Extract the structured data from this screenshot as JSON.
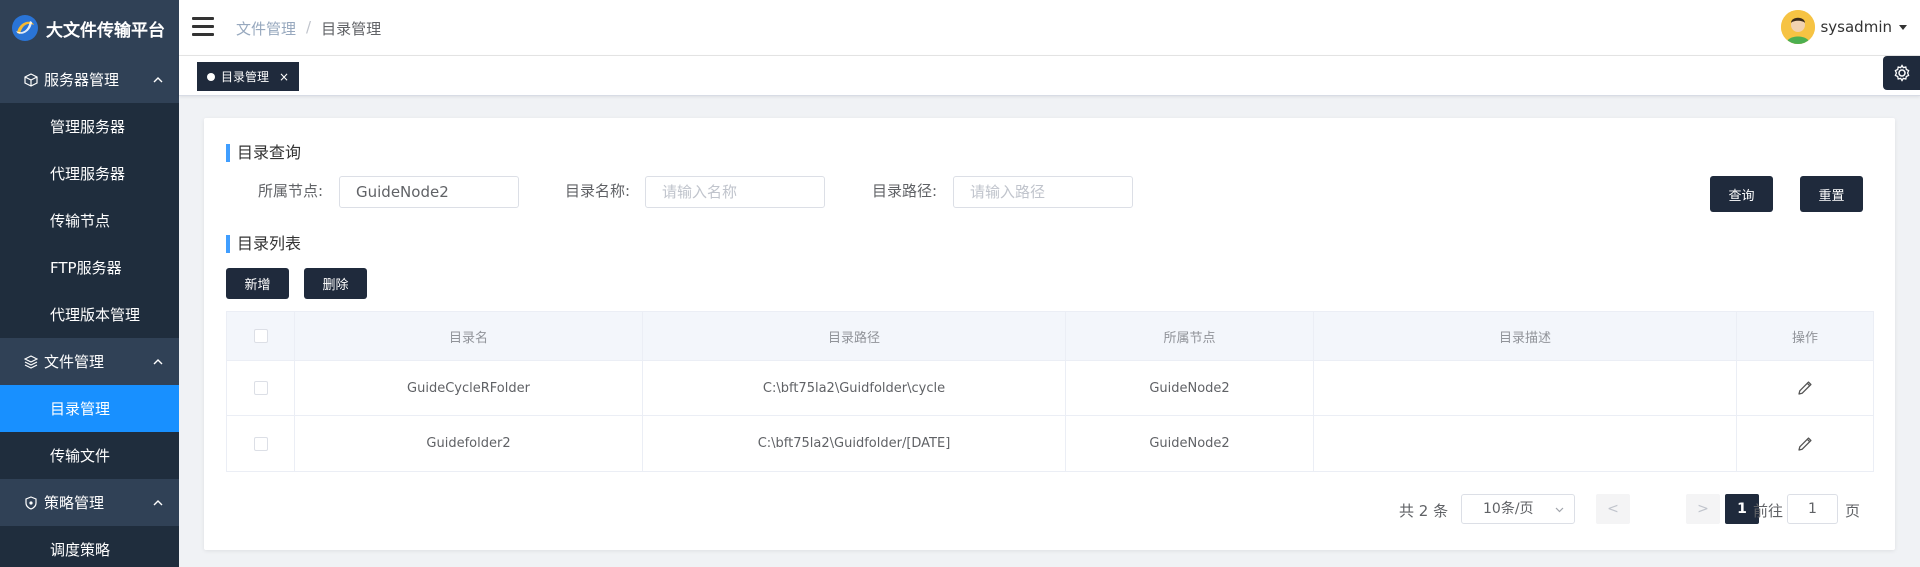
{
  "brand": {
    "title": "大文件传输平台",
    "logo_icon": "swirl-logo-icon"
  },
  "sidebar": {
    "groups": [
      {
        "label": "服务器管理",
        "icon": "cube-icon",
        "items": [
          "管理服务器",
          "代理服务器",
          "传输节点",
          "FTP服务器",
          "代理版本管理"
        ]
      },
      {
        "label": "文件管理",
        "icon": "layers-icon",
        "items": [
          "目录管理",
          "传输文件"
        ]
      },
      {
        "label": "策略管理",
        "icon": "shield-icon",
        "items": [
          "调度策略"
        ]
      }
    ],
    "active_item": "目录管理"
  },
  "header": {
    "breadcrumb": [
      "文件管理",
      "目录管理"
    ],
    "breadcrumb_sep": "/",
    "username": "sysadmin"
  },
  "tags": {
    "active": "目录管理",
    "close": "×"
  },
  "query": {
    "title": "目录查询",
    "node_label": "所属节点:",
    "node_value": "GuideNode2",
    "name_label": "目录名称:",
    "name_placeholder": "请输入名称",
    "path_label": "目录路径:",
    "path_placeholder": "请输入路径",
    "search_btn": "查询",
    "reset_btn": "重置"
  },
  "list": {
    "title": "目录列表",
    "add_btn": "新增",
    "delete_btn": "删除",
    "columns": [
      "目录名",
      "目录路径",
      "所属节点",
      "目录描述",
      "操作"
    ],
    "rows": [
      {
        "name": "GuideCycleRFolder",
        "path": "C:\\bft75la2\\Guidfolder\\cycle",
        "node": "GuideNode2",
        "desc": ""
      },
      {
        "name": "Guidefolder2",
        "path": "C:\\bft75la2\\Guidfolder/[DATE]",
        "node": "GuideNode2",
        "desc": ""
      }
    ]
  },
  "pagination": {
    "total": "共 2 条",
    "page_size": "10条/页",
    "prev": "<",
    "next": ">",
    "current_page": "1",
    "goto_prefix": "前往",
    "goto_value": "1",
    "goto_suffix": "页"
  },
  "colors": {
    "sidebar": "#304156",
    "submenu": "#1f2d3d",
    "active": "#1890ff",
    "dark_button": "#1f2a3c",
    "accent": "#409eff"
  }
}
